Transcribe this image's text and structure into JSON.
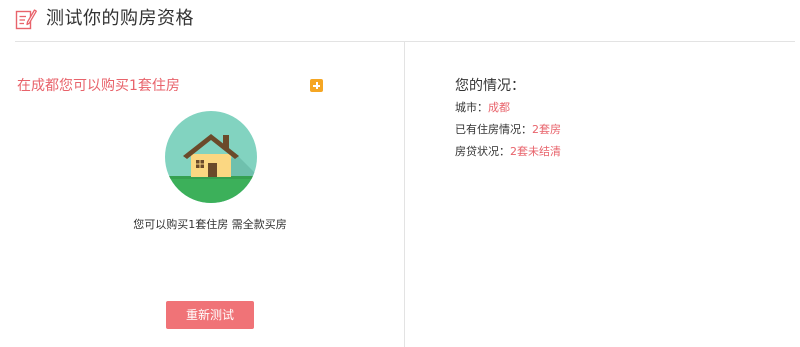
{
  "header": {
    "title": "测试你的购房资格",
    "icon": "edit-document-icon"
  },
  "result": {
    "heading": "在成都您可以购买1套住房",
    "expand_icon": "plus-square-icon",
    "illustration": "house-icon",
    "caption": "您可以购买1套住房 需全款买房",
    "retest_label": "重新测试"
  },
  "situation": {
    "title": "您的情况：",
    "rows": [
      {
        "label": "城市：",
        "value": "成都"
      },
      {
        "label": "已有住房情况：",
        "value": "2套房"
      },
      {
        "label": "房贷状况：",
        "value": "2套未结清"
      }
    ]
  },
  "colors": {
    "accent": "#e8636b",
    "button": "#f07377",
    "expand_icon": "#f5a623",
    "circle": "#82d3c0",
    "ground": "#3cb05a"
  }
}
